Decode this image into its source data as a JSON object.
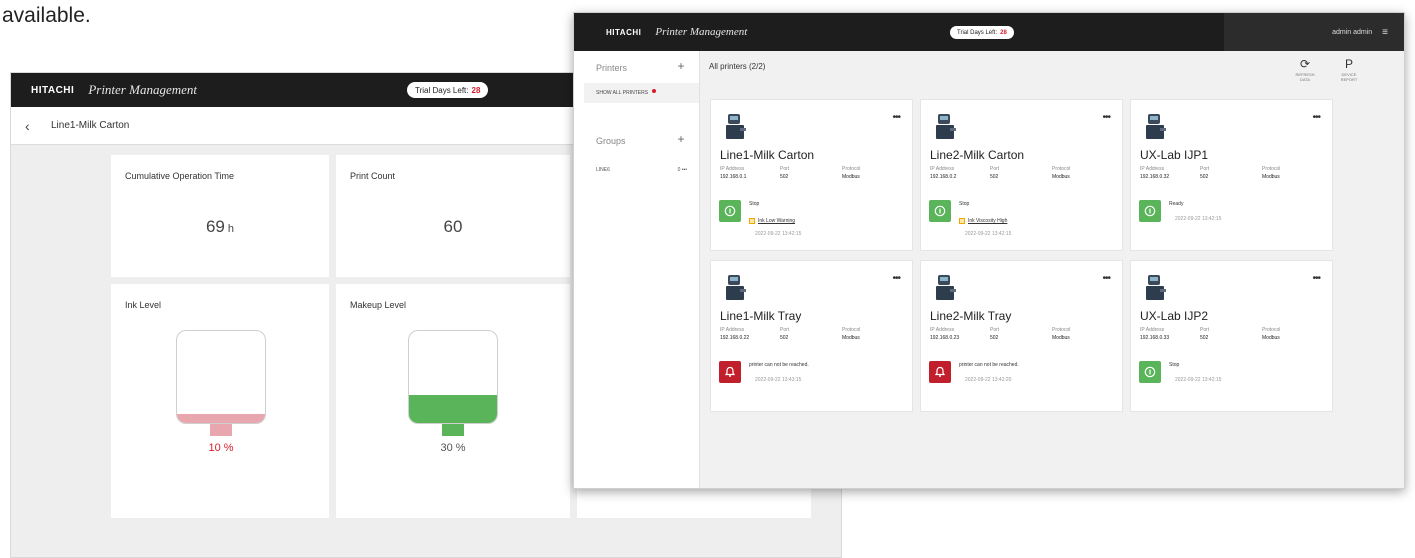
{
  "caption": "available.",
  "colors": {
    "topbar": "#1d1d1d",
    "accent_red": "#d61d2e",
    "ok_green": "#5ab55a",
    "error_red": "#c01f2b",
    "ink_low": "#e8a7ae"
  },
  "detail": {
    "logo": "HITACHI",
    "app_title": "Printer Management",
    "trial_label": "Trial Days Left:",
    "trial_days": "28",
    "back_icon": "chevron-left-icon",
    "printer_name": "Line1-Milk Carton",
    "cumulative_label": "Cumulative Operation Time",
    "cumulative_value": "69",
    "cumulative_unit": "h",
    "print_count_label": "Print Count",
    "print_count_value": "60",
    "ink_label": "Ink Level",
    "ink_percent_text": "10 %",
    "ink_fraction": 0.1,
    "makeup_label": "Makeup Level",
    "makeup_percent_text": "30 %",
    "makeup_fraction": 0.3
  },
  "list": {
    "logo": "HITACHI",
    "app_title": "Printer Management",
    "trial_label": "Trial Days Left:",
    "trial_days": "28",
    "user": "admin admin",
    "sidebar": {
      "printers_label": "Printers",
      "show_all": "SHOW ALL PRINTERS",
      "groups_label": "Groups",
      "group_item": "LINE6",
      "group_count": "0"
    },
    "header": "All printers (2/2)",
    "tools": [
      {
        "label": "REFRESH DATA",
        "icon": "refresh-icon"
      },
      {
        "label": "DEVICE REPORT",
        "icon": "report-icon"
      }
    ],
    "field_labels": {
      "ip": "IP Address",
      "port": "Port",
      "protocol": "Protocol"
    },
    "printers": [
      {
        "name": "Line1-Milk Carton",
        "ip": "192.168.0.1",
        "port": "502",
        "protocol": "Modbus",
        "status": "Stop",
        "state": "ok",
        "warning": "Ink Low Warning",
        "time": "2022-09-22 13:42:15"
      },
      {
        "name": "Line2-Milk Carton",
        "ip": "192.168.0.2",
        "port": "502",
        "protocol": "Modbus",
        "status": "Stop",
        "state": "ok",
        "warning": "Ink Viscosity High",
        "time": "2022-09-22 13:42:15"
      },
      {
        "name": "UX-Lab IJP1",
        "ip": "192.168.0.32",
        "port": "502",
        "protocol": "Modbus",
        "status": "Ready",
        "state": "ok",
        "warning": "",
        "time": "2022-09-22 13:42:15"
      },
      {
        "name": "Line1-Milk Tray",
        "ip": "192.168.0.22",
        "port": "502",
        "protocol": "Modbus",
        "status": "printer can not be reached.",
        "state": "err",
        "warning": "",
        "time": "2022-09-22 13:43:15"
      },
      {
        "name": "Line2-Milk Tray",
        "ip": "192.168.0.23",
        "port": "502",
        "protocol": "Modbus",
        "status": "printer can not be reached.",
        "state": "err",
        "warning": "",
        "time": "2022-09-22 13:42:20"
      },
      {
        "name": "UX-Lab IJP2",
        "ip": "192.168.0.33",
        "port": "502",
        "protocol": "Modbus",
        "status": "Stop",
        "state": "ok",
        "warning": "",
        "time": "2022-09-22 13:42:15"
      }
    ]
  }
}
